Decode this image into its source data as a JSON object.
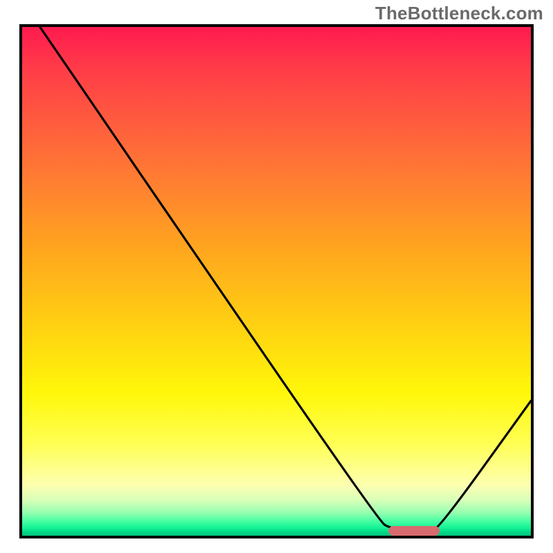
{
  "watermark": "TheBottleneck.com",
  "chart_data": {
    "type": "line",
    "title": "",
    "xlabel": "",
    "ylabel": "",
    "x_range": [
      0,
      100
    ],
    "y_range": [
      0,
      100
    ],
    "background_gradient_stops": [
      {
        "pos": 0.0,
        "color": "#ff1a4f"
      },
      {
        "pos": 0.18,
        "color": "#ff5a3f"
      },
      {
        "pos": 0.43,
        "color": "#ffa41f"
      },
      {
        "pos": 0.72,
        "color": "#fff70a"
      },
      {
        "pos": 0.9,
        "color": "#fdffb0"
      },
      {
        "pos": 0.96,
        "color": "#78ffac"
      },
      {
        "pos": 1.0,
        "color": "#00c47d"
      }
    ],
    "series": [
      {
        "name": "bottleneck-curve",
        "points": [
          {
            "x": 3.5,
            "y": 100.0
          },
          {
            "x": 22.0,
            "y": 73.0
          },
          {
            "x": 25.0,
            "y": 68.5
          },
          {
            "x": 70.0,
            "y": 3.0
          },
          {
            "x": 72.5,
            "y": 1.3
          },
          {
            "x": 80.0,
            "y": 1.0
          },
          {
            "x": 82.0,
            "y": 1.5
          },
          {
            "x": 100.0,
            "y": 26.5
          }
        ]
      }
    ],
    "marker": {
      "name": "optimum-band",
      "x_start": 72,
      "x_end": 82,
      "y": 0.9,
      "color": "#d86b6f"
    }
  }
}
